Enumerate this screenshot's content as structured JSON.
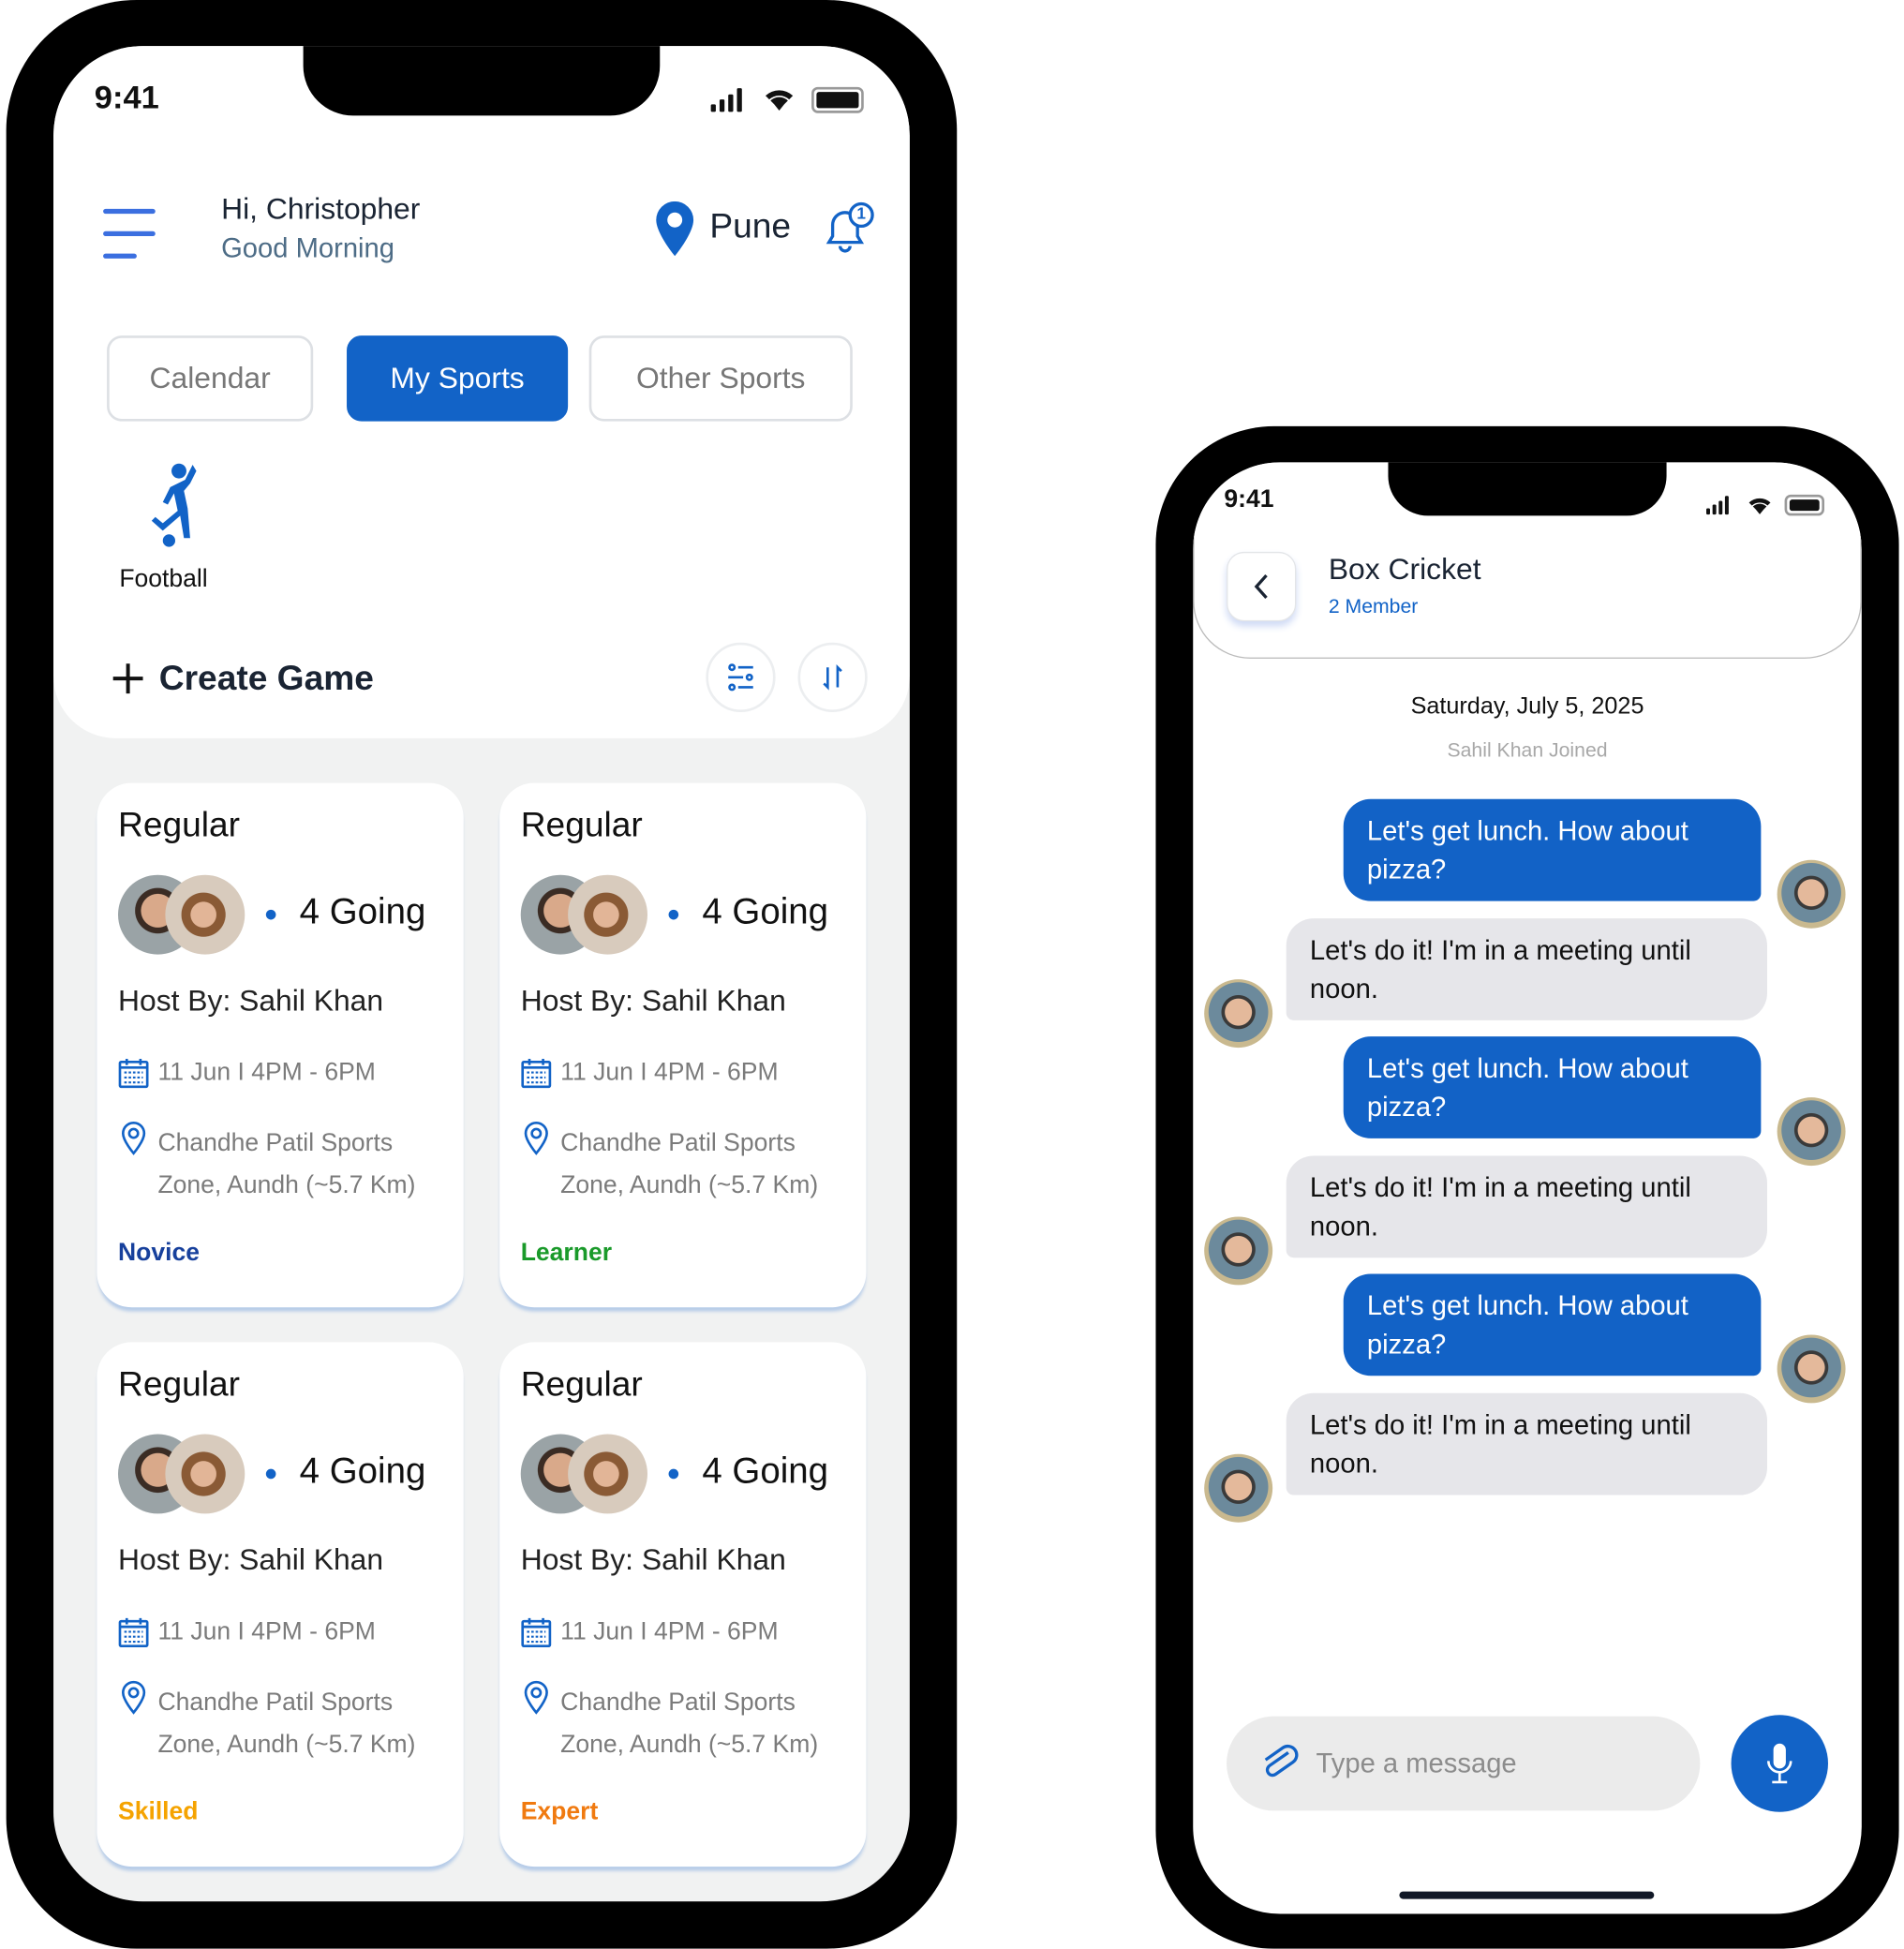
{
  "colors": {
    "accent": "#1263c7",
    "novice": "#17409c",
    "learner": "#1a9a2a",
    "skilled": "#f5a300",
    "expert": "#f07a10"
  },
  "home": {
    "status_time": "9:41",
    "greeting": "Hi, Christopher",
    "subgreeting": "Good Morning",
    "location": "Pune",
    "notification_count": "1",
    "tabs": [
      {
        "label": "Calendar"
      },
      {
        "label": "My Sports"
      },
      {
        "label": "Other Sports"
      }
    ],
    "active_tab": "My Sports",
    "sport": {
      "label": "Football",
      "icon": "football-player-icon"
    },
    "create_game": "Create Game",
    "cards": [
      {
        "type": "Regular",
        "going": "4 Going",
        "host": "Host By: Sahil Khan",
        "time": "11 Jun I 4PM - 6PM",
        "venue_line1": "Chandhe Patil Sports",
        "venue_line2": "Zone, Aundh (~5.7 Km)",
        "level": "Novice",
        "level_color": "#17409c"
      },
      {
        "type": "Regular",
        "going": "4 Going",
        "host": "Host By: Sahil Khan",
        "time": "11 Jun I 4PM - 6PM",
        "venue_line1": "Chandhe Patil Sports",
        "venue_line2": "Zone, Aundh (~5.7 Km)",
        "level": "Learner",
        "level_color": "#1a9a2a"
      },
      {
        "type": "Regular",
        "going": "4 Going",
        "host": "Host By: Sahil Khan",
        "time": "11 Jun I 4PM - 6PM",
        "venue_line1": "Chandhe Patil Sports",
        "venue_line2": "Zone, Aundh (~5.7 Km)",
        "level": "Skilled",
        "level_color": "#f5a300"
      },
      {
        "type": "Regular",
        "going": "4 Going",
        "host": "Host By: Sahil Khan",
        "time": "11 Jun I 4PM - 6PM",
        "venue_line1": "Chandhe Patil Sports",
        "venue_line2": "Zone, Aundh (~5.7 Km)",
        "level": "Expert",
        "level_color": "#f07a10"
      }
    ]
  },
  "chat": {
    "status_time": "9:41",
    "title": "Box Cricket",
    "members": "2 Member",
    "date": "Saturday, July 5, 2025",
    "system_message": "Sahil Khan Joined",
    "messages": [
      {
        "direction": "out",
        "text": "Let's get lunch. How about pizza?"
      },
      {
        "direction": "in",
        "text": "Let's do it! I'm in a meeting until noon."
      },
      {
        "direction": "out",
        "text": "Let's get lunch. How about pizza?"
      },
      {
        "direction": "in",
        "text": "Let's do it! I'm in a meeting until noon."
      },
      {
        "direction": "out",
        "text": "Let's get lunch. How about pizza?"
      },
      {
        "direction": "in",
        "text": "Let's do it! I'm in a meeting until noon."
      }
    ],
    "input_placeholder": "Type a message"
  }
}
